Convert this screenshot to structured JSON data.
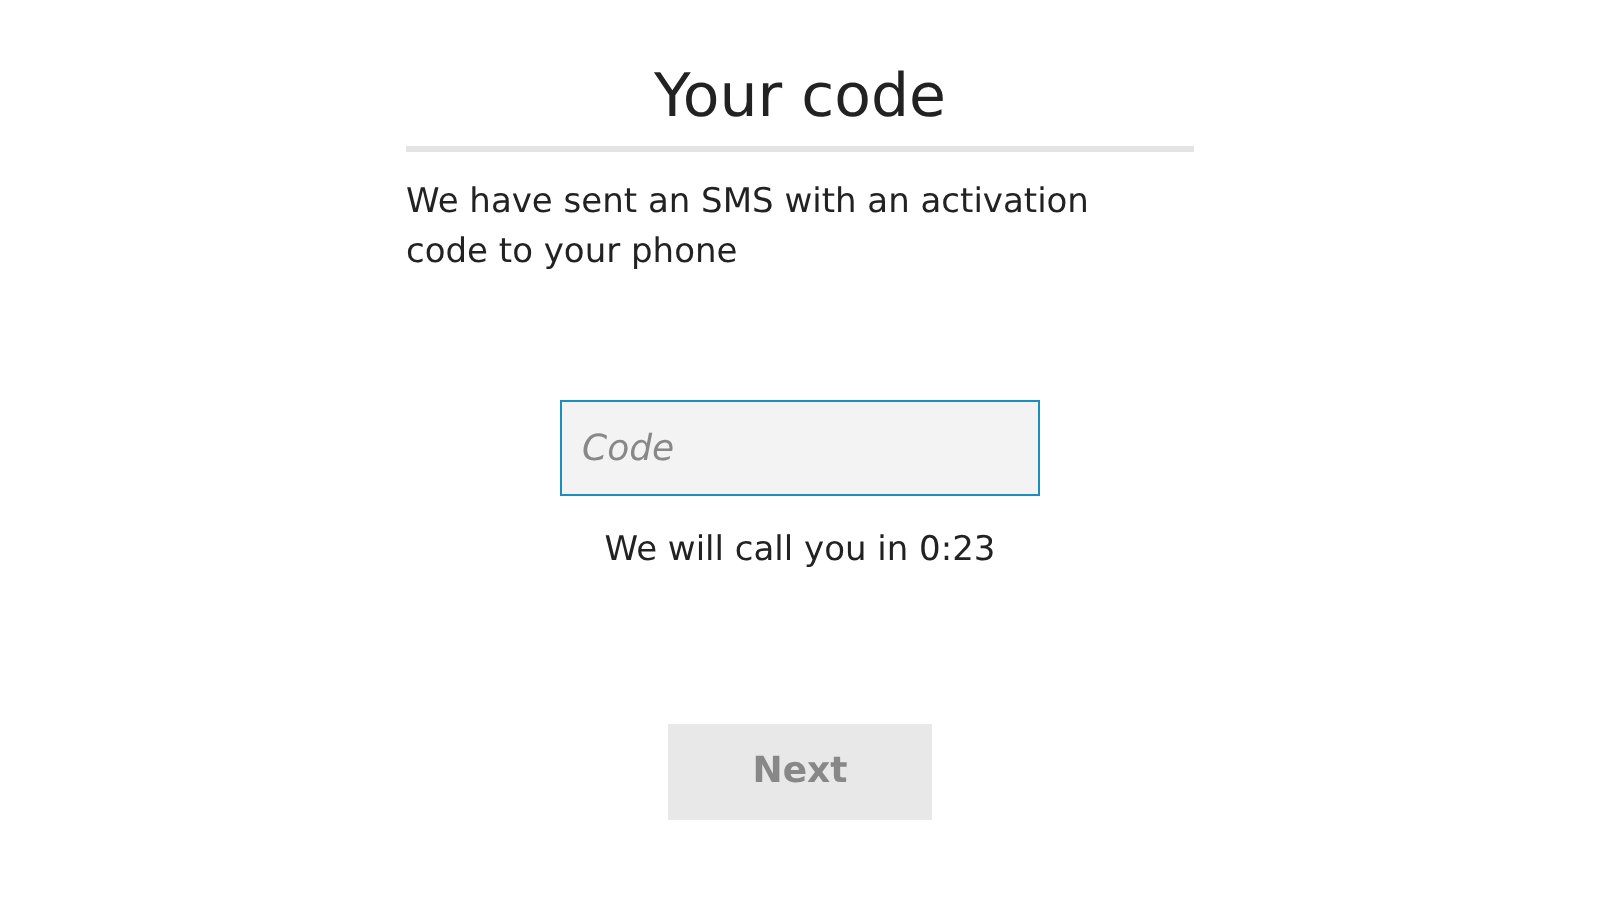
{
  "title": "Your code",
  "description": "We have sent an SMS with an activation code to your phone",
  "code_field": {
    "placeholder": "Code"
  },
  "callback_notice": "We will call you in 0:23",
  "next_button": {
    "label": "Next",
    "disabled": true
  }
}
